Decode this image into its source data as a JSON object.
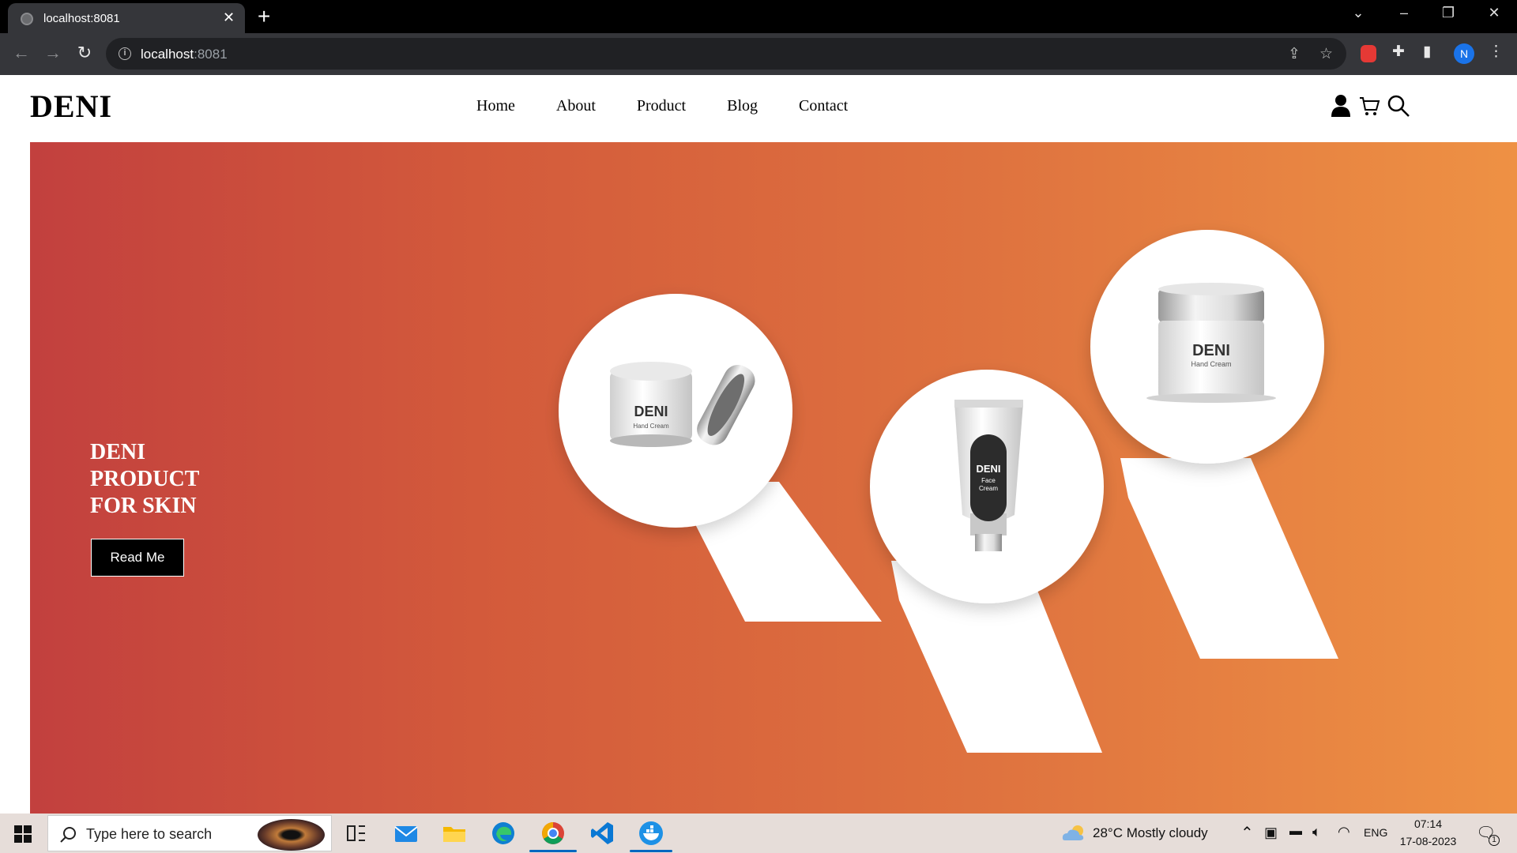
{
  "browser": {
    "tab_title": "localhost:8081",
    "url_host": "localhost",
    "url_port": ":8081",
    "profile_initial": "N",
    "icons": [
      "back-icon",
      "forward-icon",
      "reload-icon",
      "info-icon",
      "share-icon",
      "star-icon",
      "extension-icon",
      "puzzle-icon",
      "sidepanel-icon",
      "menu-icon"
    ]
  },
  "site": {
    "logo": "DENI",
    "nav": [
      "Home",
      "About",
      "Product",
      "Blog",
      "Contact"
    ],
    "icons": [
      "user-icon",
      "cart-icon",
      "search-icon"
    ]
  },
  "hero": {
    "title_lines": [
      "DENI",
      "PRODUCT",
      "FOR SKIN"
    ],
    "button_label": "Read Me",
    "gradient": [
      "#c2403e",
      "#ee9144"
    ],
    "products": [
      {
        "brand": "DENI",
        "name": "Hand Cream"
      },
      {
        "brand": "DENI",
        "name_line1": "Face",
        "name_line2": "Cream"
      },
      {
        "brand": "DENI",
        "name": "Hand Cream"
      }
    ]
  },
  "taskbar": {
    "search_placeholder": "Type here to search",
    "weather": "28°C  Mostly cloudy",
    "lang": "ENG",
    "time": "07:14",
    "date": "17-08-2023",
    "notification_count": "1"
  }
}
